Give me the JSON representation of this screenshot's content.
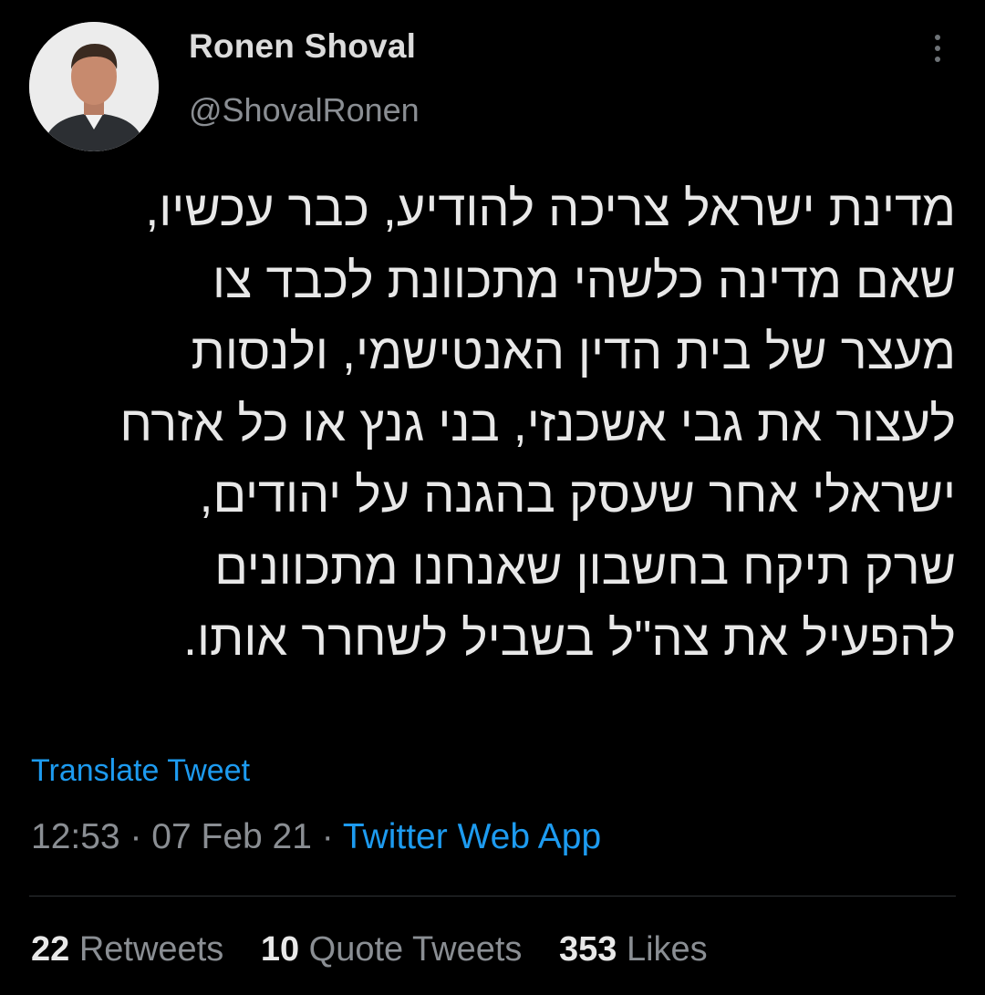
{
  "author": {
    "name": "Ronen Shoval",
    "handle": "@ShovalRonen"
  },
  "tweet": {
    "text": "מדינת ישראל צריכה להודיע, כבר עכשיו,\nשאם מדינה כלשהי מתכוונת לכבד צו\nמעצר של בית הדין האנטישמי, ולנסות\nלעצור את גבי אשכנזי, בני גנץ או כל אזרח\nישראלי אחר שעסק בהגנה על יהודים,\nשרק תיקח בחשבון שאנחנו מתכוונים\nלהפעיל את צה\"ל בשביל לשחרר אותו.",
    "translate_label": "Translate Tweet",
    "time": "12:53",
    "separator": " · ",
    "date": "07 Feb 21",
    "source": "Twitter Web App"
  },
  "stats": {
    "retweets_count": "22",
    "retweets_label": "Retweets",
    "quotes_count": "10",
    "quotes_label": "Quote Tweets",
    "likes_count": "353",
    "likes_label": "Likes"
  },
  "icons": {
    "more": "more-vertical-icon",
    "avatar": "profile-photo"
  },
  "colors": {
    "background": "#000000",
    "accent": "#1d9bf0",
    "secondary_text": "#8a8e93",
    "primary_text": "#e8e8e8",
    "divider": "#2f3336"
  }
}
